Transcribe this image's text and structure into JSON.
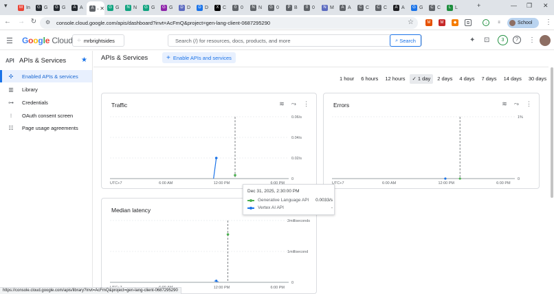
{
  "browser": {
    "tabs": [
      {
        "icon": "gmail-icon",
        "glyph": "M",
        "color": "#ea4335",
        "label": "In"
      },
      {
        "icon": "github-icon",
        "glyph": "G",
        "color": "#24292f",
        "label": "G"
      },
      {
        "icon": "github-icon",
        "glyph": "G",
        "color": "#24292f",
        "label": "G"
      },
      {
        "icon": "github-icon",
        "glyph": "A",
        "color": "#24292f",
        "label": "A"
      },
      {
        "icon": "ai-studio-icon",
        "glyph": "A",
        "color": "#5f6368",
        "label": "A"
      },
      {
        "icon": "chat-icon",
        "glyph": "G",
        "color": "#10a37f",
        "label": "G"
      },
      {
        "icon": "chat-icon",
        "glyph": "N",
        "color": "#10a37f",
        "label": "N"
      },
      {
        "icon": "chat-icon",
        "glyph": "G",
        "color": "#10a37f",
        "label": "G"
      },
      {
        "icon": "gemini-icon",
        "glyph": "G",
        "color": "#8e24aa",
        "label": "G"
      },
      {
        "icon": "bookmark-icon",
        "glyph": "D",
        "color": "#5c6bc0",
        "label": "D"
      },
      {
        "icon": "send-icon",
        "glyph": "D",
        "color": "#1a73e8",
        "label": "D"
      },
      {
        "icon": "x-icon",
        "glyph": "X",
        "color": "#000000",
        "label": "C"
      },
      {
        "icon": "gear-icon",
        "glyph": "0",
        "color": "#5f6368",
        "label": "0"
      },
      {
        "icon": "gear-icon",
        "glyph": "N",
        "color": "#5f6368",
        "label": "N"
      },
      {
        "icon": "globe-icon",
        "glyph": "G",
        "color": "#5f6368",
        "label": "0"
      },
      {
        "icon": "pin-icon",
        "glyph": "P",
        "color": "#5f6368",
        "label": "B"
      },
      {
        "icon": "globe-icon",
        "glyph": "0",
        "color": "#5f6368",
        "label": "0"
      },
      {
        "icon": "bookmark-icon",
        "glyph": "N",
        "color": "#5c6bc0",
        "label": "M"
      },
      {
        "icon": "ai-studio-icon",
        "glyph": "A",
        "color": "#5f6368",
        "label": "A"
      },
      {
        "icon": "chat-icon",
        "glyph": "C",
        "color": "#5f6368",
        "label": "C"
      },
      {
        "icon": "chat-icon",
        "glyph": "C",
        "color": "#5f6368",
        "label": "C"
      },
      {
        "icon": "dark-icon",
        "glyph": "A",
        "color": "#202124",
        "label": "A"
      },
      {
        "icon": "translate-icon",
        "glyph": "G",
        "color": "#1a73e8",
        "label": "G"
      },
      {
        "icon": "sparkle-icon",
        "glyph": "C",
        "color": "#5f6368",
        "label": "C"
      },
      {
        "icon": "mail-icon",
        "glyph": "L",
        "color": "#1e8e3e",
        "label": "L"
      }
    ],
    "url": "console.cloud.google.com/apis/dashboard?invt=AcFmQ&project=gen-lang-client-0687295290",
    "profile_label": "School",
    "status_url": "https://console.cloud.google.com/apis/library?invt=AcFmQ&project=gen-lang-client-0687295290"
  },
  "header": {
    "logo_google": [
      "G",
      "o",
      "o",
      "g",
      "l",
      "e"
    ],
    "logo_cloud": "Cloud",
    "project": "mrbrightsides",
    "search_placeholder": "Search (/) for resources, docs, products, and more",
    "search_button": "Search",
    "notification_count": "3"
  },
  "sidebar": {
    "api_label": "API",
    "title": "APIs & Services",
    "items": [
      {
        "label": "Enabled APIs & services",
        "icon": "diamond-icon",
        "active": true
      },
      {
        "label": "Library",
        "icon": "library-icon",
        "active": false
      },
      {
        "label": "Credentials",
        "icon": "key-icon",
        "active": false
      },
      {
        "label": "OAuth consent screen",
        "icon": "consent-icon",
        "active": false
      },
      {
        "label": "Page usage agreements",
        "icon": "agreement-icon",
        "active": false
      }
    ]
  },
  "main": {
    "title": "APIs & Services",
    "enable_button": "Enable APIs and services",
    "time_ranges": [
      "1 hour",
      "6 hours",
      "12 hours",
      "1 day",
      "2 days",
      "4 days",
      "7 days",
      "14 days",
      "30 days"
    ],
    "selected_time_range": "1 day"
  },
  "charts": {
    "traffic": {
      "title": "Traffic",
      "y_ticks": [
        "0.06/s",
        "0.04/s",
        "0.02/s",
        "0"
      ],
      "x_ticks": [
        "UTC+7",
        "6:00 AM",
        "12:00 PM",
        "6:00 PM"
      ]
    },
    "errors": {
      "title": "Errors",
      "y_ticks": [
        "1%",
        "0"
      ],
      "x_ticks": [
        "UTC+7",
        "6:00 AM",
        "12:00 PM",
        "6:00 PM"
      ]
    },
    "latency": {
      "title": "Median latency",
      "y_ticks": [
        "2milliseconds",
        "1millisecond",
        "0"
      ],
      "x_ticks": [
        "UTC+7",
        "6:00 AM",
        "12:00 PM",
        "6:00 PM"
      ]
    }
  },
  "tooltip": {
    "date": "Dec 31, 2025, 2:30:00 PM",
    "rows": [
      {
        "name": "Generative Language API",
        "value": "0.0033/s",
        "color": "#4caf50"
      },
      {
        "name": "Vertex AI API",
        "value": "-",
        "color": "#1a73e8"
      }
    ]
  },
  "chart_data": [
    {
      "type": "line",
      "title": "Traffic",
      "ylabel": "",
      "ylim": [
        0,
        0.06
      ],
      "x": [
        "UTC+7",
        "6:00 AM",
        "12:00 PM",
        "6:00 PM"
      ],
      "series": [
        {
          "name": "Vertex AI API",
          "color": "#1a73e8",
          "values": [
            0,
            0.02
          ]
        },
        {
          "name": "Generative Language API",
          "color": "#4caf50",
          "values": [
            0.0033
          ]
        }
      ]
    },
    {
      "type": "line",
      "title": "Errors",
      "ylim": [
        0,
        1
      ],
      "x": [
        "UTC+7",
        "6:00 AM",
        "12:00 PM",
        "6:00 PM"
      ],
      "series": []
    },
    {
      "type": "line",
      "title": "Median latency",
      "ylim": [
        0,
        2
      ],
      "x": [
        "UTC+7",
        "6:00 AM",
        "12:00 PM",
        "6:00 PM"
      ],
      "series": [
        {
          "name": "Generative Language API",
          "color": "#4caf50",
          "values": [
            1.55
          ]
        },
        {
          "name": "Vertex AI API",
          "color": "#1a73e8",
          "values": [
            0.05
          ]
        }
      ]
    }
  ]
}
